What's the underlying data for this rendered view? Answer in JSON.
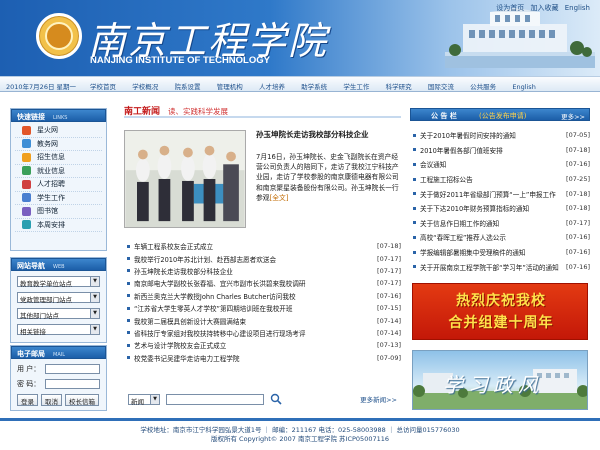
{
  "header": {
    "school_name": "南京工程学院",
    "school_name_en": "NANJING INSTITUTE OF TECHNOLOGY",
    "links": [
      "设为首页",
      "加入收藏",
      "English"
    ]
  },
  "nav": {
    "date": "2010年7月26日 星期一",
    "items": [
      "学校首页",
      "学校概况",
      "院系设置",
      "管理机构",
      "人才培养",
      "助学系统",
      "学生工作",
      "科学研究",
      "国际交流",
      "公共服务",
      "English"
    ]
  },
  "quick_links": {
    "title": "快速链接",
    "title_en": "LINKS",
    "items": [
      {
        "label": "星火网",
        "color": "#e2572a"
      },
      {
        "label": "教务网",
        "color": "#3f8fd6"
      },
      {
        "label": "招生信息",
        "color": "#f0a020"
      },
      {
        "label": "就业信息",
        "color": "#3ba05a"
      },
      {
        "label": "人才招聘",
        "color": "#d04040"
      },
      {
        "label": "学生工作",
        "color": "#4a7fd0"
      },
      {
        "label": "图书馆",
        "color": "#7a5fc0"
      },
      {
        "label": "本周安排",
        "color": "#2a9fb0"
      }
    ]
  },
  "site_nav": {
    "title": "网站导航",
    "title_en": "WEB",
    "selects": [
      "教育教学单位站点",
      "党政管理部门站点",
      "其他部门站点",
      "相关链接"
    ]
  },
  "mail": {
    "title": "电子邮局",
    "title_en": "MAIL",
    "user_label": "用 户：",
    "password_label": "密 码：",
    "buttons": [
      "登录",
      "取消",
      "校长信箱"
    ]
  },
  "center": {
    "title": "南工新闻",
    "subtitle": "读、实践科学发展",
    "featured": {
      "title": "孙玉坤院长走访我校部分科技企业",
      "text": "7月16日，孙玉坤院长、史金飞副院长在资产经营公司负责人的陪同下，走访了我校江宁科技产业园，走访了学校参股的南京康德电器有限公司和南京聚星装备股份有限公司。孙玉坤院长一行参观",
      "more": "[全文]"
    },
    "news": [
      {
        "title": "车辆工程系校友会正式成立",
        "date": "[07-18]"
      },
      {
        "title": "我校举行2010年苏北计划、赴西部志愿者欢送会",
        "date": "[07-17]"
      },
      {
        "title": "孙玉坤院长走访我校部分科技企业",
        "date": "[07-17]"
      },
      {
        "title": "南京邮电大学副校长张春福、宜兴市副市长洪碧来我校调研",
        "date": "[07-17]"
      },
      {
        "title": "新西兰奥克兰大学教授John Charles Butcher访问我校",
        "date": "[07-16]"
      },
      {
        "title": "“江苏省大学生零英人才学校”第四期培训班在我校开班",
        "date": "[07-15]"
      },
      {
        "title": "我校第二届模具创新设计大赛圆满结束",
        "date": "[07-14]"
      },
      {
        "title": "省科技厅专家组对我校扶持转移中心建设项目进行现场考评",
        "date": "[07-14]"
      },
      {
        "title": "艺术与设计学院校友会正式成立",
        "date": "[07-13]"
      },
      {
        "title": "校党委书记吴建华走访电力工程学院",
        "date": "[07-09]"
      }
    ],
    "search_select": "新闻",
    "more_news": "更多新闻>>"
  },
  "notice": {
    "title": "公 告 栏",
    "subtitle": "(公告发布申请)",
    "more": "更多>>",
    "items": [
      {
        "title": "关于2010年暑假时间安排的通知",
        "date": "[07-05]"
      },
      {
        "title": "2010年暑假各部门值班安排",
        "date": "[07-18]"
      },
      {
        "title": "会议通知",
        "date": "[07-16]"
      },
      {
        "title": "工程施工招标公告",
        "date": "[07-25]"
      },
      {
        "title": "关于做好2011年省级部门预算“一上”申报工作",
        "date": "[07-18]"
      },
      {
        "title": "关于下达2010年财务预算指标的通知",
        "date": "[07-18]"
      },
      {
        "title": "关于信息作日期工作的通知",
        "date": "[07-17]"
      },
      {
        "title": "高校“春晖工程”推荐人选公示",
        "date": "[07-16]"
      },
      {
        "title": "学报编辑部暑期集中受理稿件的通知",
        "date": "[07-16]"
      },
      {
        "title": "关于开展南京工程学院干部“学习年”活动的通知",
        "date": "[07-16]"
      }
    ]
  },
  "banners": {
    "anniversary_line1": "热烈庆祝我校",
    "anniversary_line2": "合并组建十周年",
    "campus_text": "学习政风"
  },
  "footer": {
    "line1": "学校地址：南京市江宁科学园弘景大道1号 ｜ 邮编：211167 电话：025-58003988 ｜ 总访问量015776030",
    "line2": "版权所有 Copyright© 2007 南京工程学院 苏ICP05007116"
  },
  "colors": {
    "brand_blue": "#1d5fb2",
    "news_red": "#c41a1a",
    "banner_red": "#d42a10",
    "banner_gold": "#ffe24a"
  }
}
